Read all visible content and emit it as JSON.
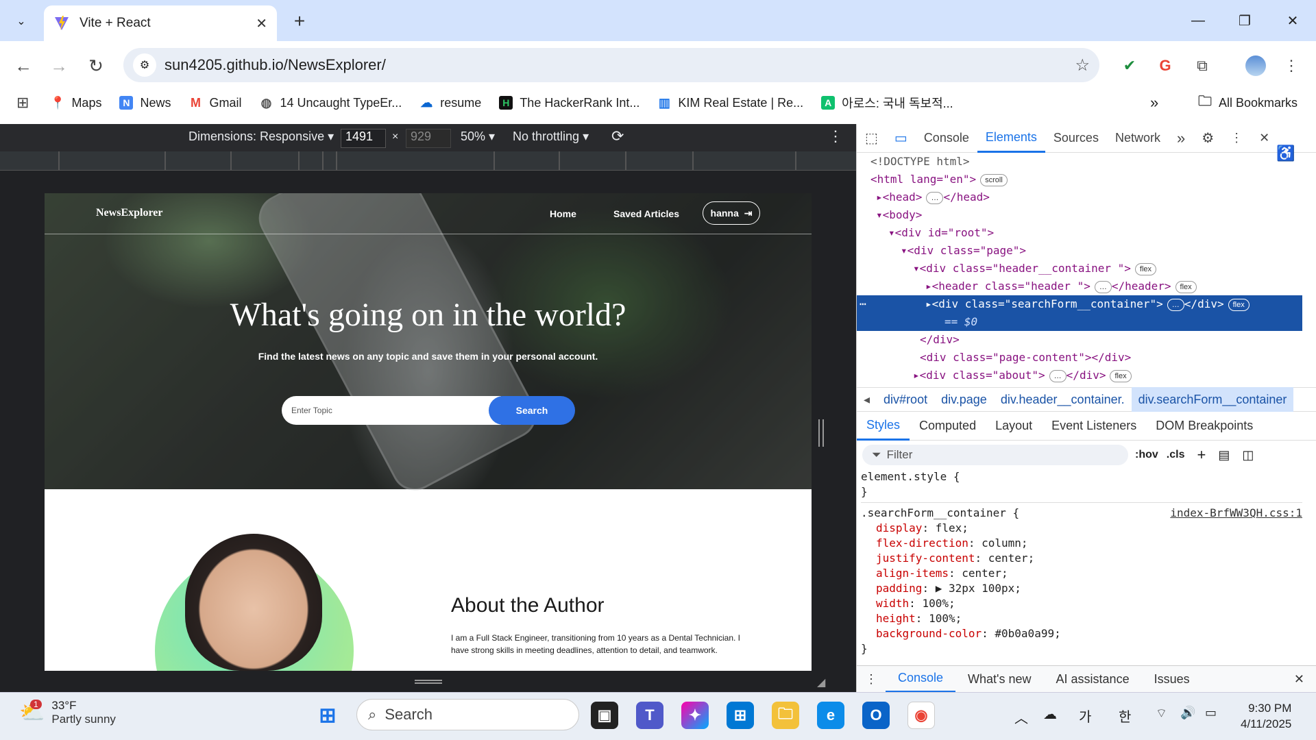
{
  "browser": {
    "tab_title": "Vite + React",
    "url": "sun4205.github.io/NewsExplorer/",
    "bookmarks": [
      "Maps",
      "News",
      "Gmail",
      "14 Uncaught TypeEr...",
      "resume",
      "The HackerRank Int...",
      "KIM Real Estate | Re...",
      "아로스: 국내 독보적..."
    ],
    "all_bookmarks": "All Bookmarks",
    "more": "»"
  },
  "device_toolbar": {
    "dimensions_label": "Dimensions: Responsive",
    "width": "1491",
    "times": "×",
    "height": "929",
    "zoom": "50%",
    "throttling": "No throttling"
  },
  "site": {
    "logo": "NewsExplorer",
    "nav_home": "Home",
    "nav_saved": "Saved Articles",
    "user": "hanna",
    "hero_title": "What's going on in the world?",
    "hero_sub": "Find the latest news on any topic and save them in your personal account.",
    "search_placeholder": "Enter Topic",
    "search_button": "Search",
    "about_title": "About the Author",
    "about_text": "I am a Full Stack Engineer, transitioning from 10 years as a Dental Technician. I have strong skills in meeting deadlines, attention to detail, and teamwork."
  },
  "devtools": {
    "tabs": [
      "Console",
      "Elements",
      "Sources",
      "Network"
    ],
    "active_tab": "Elements",
    "dom": {
      "doctype": "<!DOCTYPE html>",
      "html_open": "<html lang=\"en\">",
      "scroll_pill": "scroll",
      "head": "<head>",
      "head_close": "</head>",
      "body": "<body>",
      "root": "<div id=\"root\">",
      "page": "<div class=\"page\">",
      "header_container": "<div class=\"header__container \">",
      "header": "<header class=\"header \">",
      "header_close": "</header>",
      "search_form": "<div class=\"searchForm__container\">",
      "div_close": "</div>",
      "eq": "== $0",
      "page_content": "<div class=\"page-content\"></div>",
      "about": "<div class=\"about\">",
      "flex_pill": "flex"
    },
    "breadcrumbs": [
      "div#root",
      "div.page",
      "div.header__container.",
      "div.searchForm__container"
    ],
    "subtabs": [
      "Styles",
      "Computed",
      "Layout",
      "Event Listeners",
      "DOM Breakpoints"
    ],
    "filter_placeholder": "Filter",
    "hov": ":hov",
    "cls": ".cls",
    "element_style": "element.style {",
    "close_brace": "}",
    "rule_selector": ".searchForm__container {",
    "rule_source": "index-BrfWW3QH.css:1",
    "props": [
      {
        "name": "display",
        "value": "flex;"
      },
      {
        "name": "flex-direction",
        "value": "column;"
      },
      {
        "name": "justify-content",
        "value": "center;"
      },
      {
        "name": "align-items",
        "value": "center;"
      },
      {
        "name": "padding",
        "value": "▶ 32px 100px;"
      },
      {
        "name": "width",
        "value": "100%;"
      },
      {
        "name": "height",
        "value": "100%;"
      },
      {
        "name": "background-color",
        "value": "#0b0a0a99;"
      }
    ],
    "drawer_tabs": [
      "Console",
      "What's new",
      "AI assistance",
      "Issues"
    ]
  },
  "taskbar": {
    "temp": "33°F",
    "condition": "Partly sunny",
    "badge": "1",
    "search": "Search",
    "ime1": "가",
    "ime2": "한",
    "time": "9:30 PM",
    "date": "4/11/2025"
  }
}
